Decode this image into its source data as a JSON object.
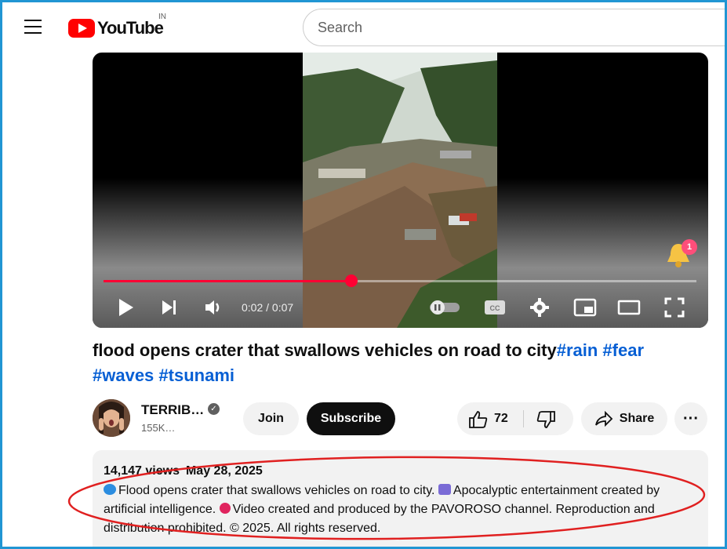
{
  "header": {
    "logo_text": "YouTube",
    "country_code": "IN",
    "search_placeholder": "Search"
  },
  "player": {
    "time_label": "0:02 / 0:07",
    "progress_fraction": 0.418,
    "notification_count": "1"
  },
  "video": {
    "title": "flood opens crater that swallows vehicles on road to city",
    "hashtags": [
      "#rain",
      "#fear",
      "#waves",
      "#tsunami"
    ]
  },
  "channel": {
    "name": "TERRIB…",
    "subscribers": "155K…",
    "join_label": "Join",
    "subscribe_label": "Subscribe"
  },
  "actions": {
    "like_count": "72",
    "share_label": "Share",
    "more_label": "···"
  },
  "description": {
    "views": "14,147 views",
    "date": "May 28, 2025",
    "line1": "Flood opens crater that swallows vehicles on road to city.",
    "line1b": "Apocalyptic entertainment created by",
    "line2": "artificial intelligence.",
    "line2b": "Video created and produced by the PAVOROSO channel. Reproduction and",
    "line3": "distribution prohibited. © 2025. All rights reserved."
  },
  "colors": {
    "brand_red": "#ff0000",
    "progress_red": "#ff0033",
    "link_blue": "#065fd4",
    "annotation_red": "#e02020",
    "frame_blue": "#2196d3"
  }
}
